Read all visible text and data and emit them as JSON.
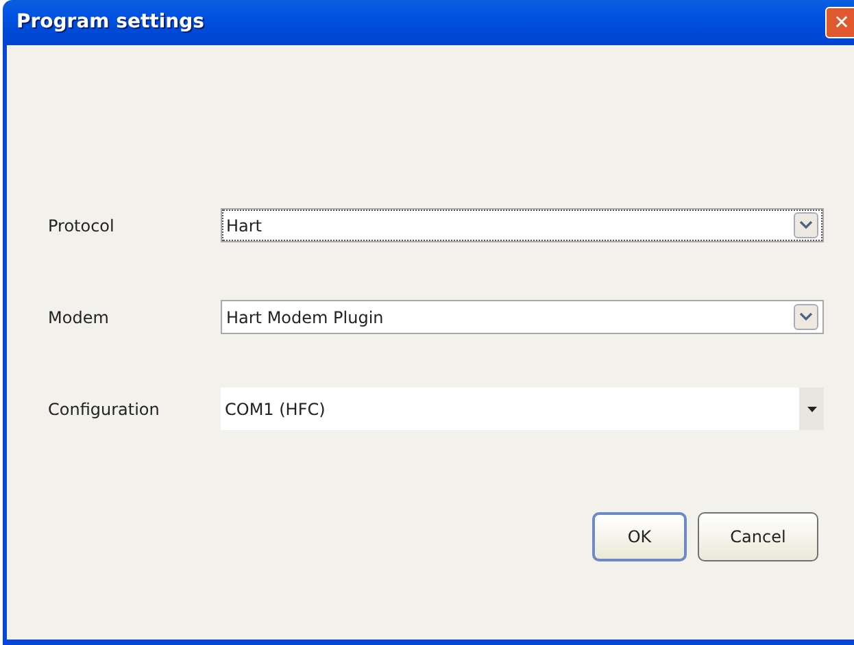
{
  "window": {
    "title": "Program settings",
    "close_label": "✕"
  },
  "fields": [
    {
      "label": "Protocol",
      "value": "Hart",
      "kind": "xp",
      "focused": true
    },
    {
      "label": "Modem",
      "value": "Hart Modem Plugin",
      "kind": "xp",
      "focused": false
    },
    {
      "label": "Configuration",
      "value": "COM1 (HFC)",
      "kind": "flat",
      "focused": false
    }
  ],
  "buttons": [
    {
      "label": "OK",
      "default": true
    },
    {
      "label": "Cancel",
      "default": false
    }
  ]
}
